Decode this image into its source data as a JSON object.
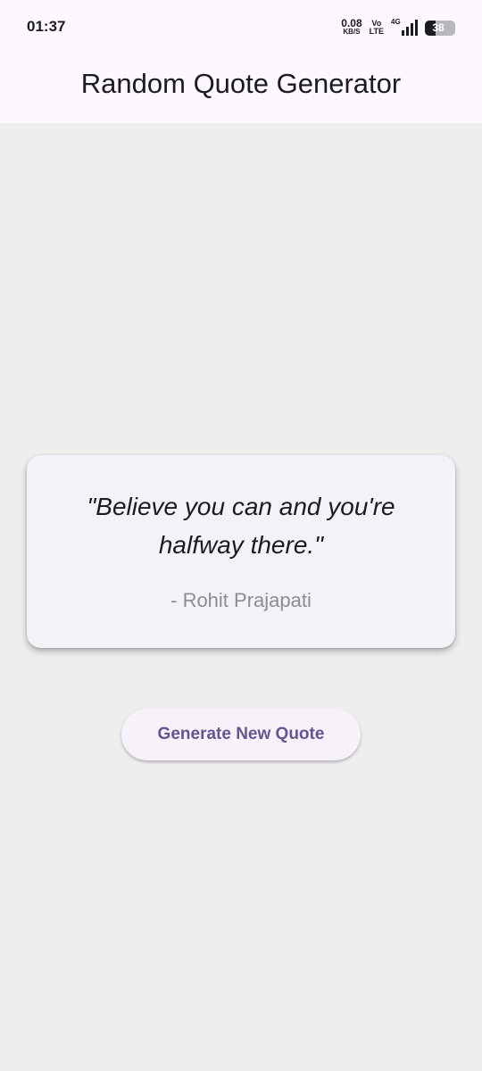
{
  "status_bar": {
    "time": "01:37",
    "net_speed_value": "0.08",
    "net_speed_unit": "KB/S",
    "volte_top": "Vo",
    "volte_bottom": "LTE",
    "network_type": "4G",
    "battery_level": "38"
  },
  "app_bar": {
    "title": "Random Quote Generator"
  },
  "quote": {
    "text": "\"Believe you can and you're halfway there.\"",
    "author": "- Rohit Prajapati"
  },
  "actions": {
    "generate_label": "Generate New Quote"
  },
  "colors": {
    "app_bar_bg": "#fdf7fe",
    "page_bg": "#eeeeee",
    "card_bg": "#f5f1f8",
    "accent": "#65558f",
    "author_text": "#8f8b95"
  }
}
